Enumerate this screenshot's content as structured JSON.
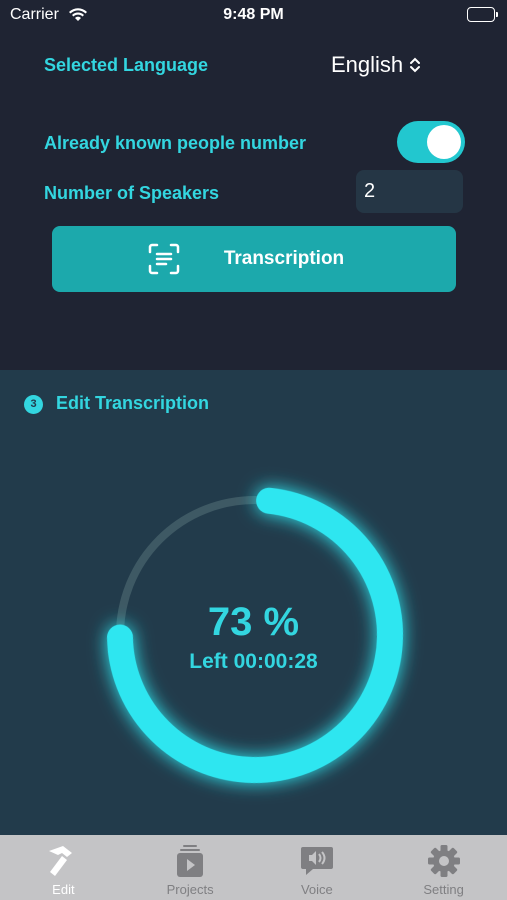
{
  "status_bar": {
    "carrier": "Carrier",
    "time": "9:48 PM"
  },
  "settings": {
    "language_label": "Selected Language",
    "language_value": "English",
    "known_people_label": "Already known people number",
    "known_people_enabled": true,
    "speakers_label": "Number of Speakers",
    "speakers_value": "2",
    "transcription_button": "Transcription"
  },
  "edit": {
    "step_number": "3",
    "title": "Edit Transcription",
    "progress_percent": 73,
    "progress_text": "73 %",
    "time_left_text": "Left 00:00:28"
  },
  "tabs": [
    {
      "label": "Edit",
      "icon": "hammer-icon",
      "active": true
    },
    {
      "label": "Projects",
      "icon": "projects-icon",
      "active": false
    },
    {
      "label": "Voice",
      "icon": "voice-icon",
      "active": false
    },
    {
      "label": "Setting",
      "icon": "gear-icon",
      "active": false
    }
  ],
  "colors": {
    "accent": "#33d6e0",
    "button": "#1ca9ac",
    "background": "#1f2433",
    "panel": "#223b4b"
  }
}
